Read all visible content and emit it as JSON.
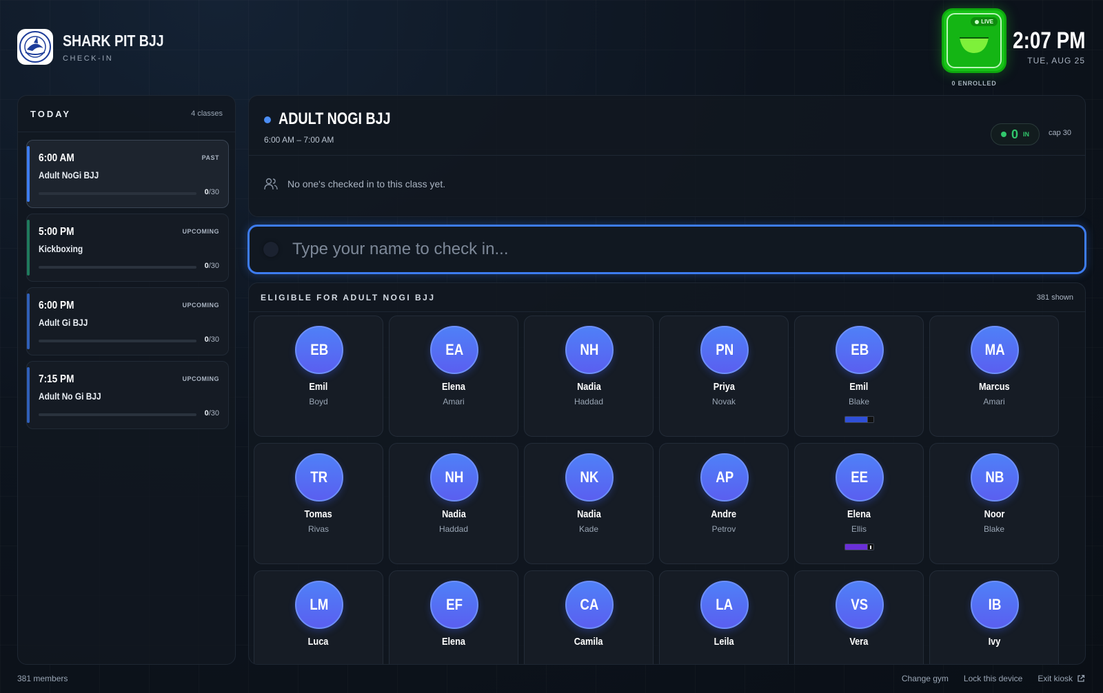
{
  "brand": {
    "name": "SHARK PIT BJJ",
    "subtitle": "CHECK-IN",
    "logo_text": "SHARK PIT BRAZILIAN JIU-JITSU"
  },
  "live": {
    "badge": "LIVE",
    "enrolled": "0 ENROLLED",
    "color": "#17c217"
  },
  "clock": {
    "time": "2:07 PM",
    "date": "TUE, AUG 25"
  },
  "sidebar": {
    "title": "TODAY",
    "count": "4 classes",
    "classes": [
      {
        "time": "6:00 AM",
        "status": "PAST",
        "name": "Adult NoGi BJJ",
        "checked": "0",
        "cap": "/30",
        "fill": 0,
        "accent": "#3d7cf0"
      },
      {
        "time": "5:00 PM",
        "status": "UPCOMING",
        "name": "Kickboxing",
        "checked": "0",
        "cap": "/30",
        "fill": 0,
        "accent": "#1f7a5c"
      },
      {
        "time": "6:00 PM",
        "status": "UPCOMING",
        "name": "Adult Gi BJJ",
        "checked": "0",
        "cap": "/30",
        "fill": 0,
        "accent": "#2f5fb8"
      },
      {
        "time": "7:15 PM",
        "status": "UPCOMING",
        "name": "Adult No Gi BJJ",
        "checked": "0",
        "cap": "/30",
        "fill": 0,
        "accent": "#2f5fb8"
      }
    ]
  },
  "class_panel": {
    "title": "ADULT NOGI BJJ",
    "times": "6:00 AM – 7:00 AM",
    "in_count": "0",
    "in_label": "IN",
    "cap": "cap 30",
    "empty_message": "No one's checked in to this class yet."
  },
  "search": {
    "placeholder": "Type your name to check in..."
  },
  "eligible": {
    "title": "ELIGIBLE FOR ADULT NOGI BJJ",
    "count": "381 shown",
    "members": [
      {
        "initials": "EB",
        "first": "Emil",
        "last": "Boyd"
      },
      {
        "initials": "EA",
        "first": "Elena",
        "last": "Amari"
      },
      {
        "initials": "NH",
        "first": "Nadia",
        "last": "Haddad"
      },
      {
        "initials": "PN",
        "first": "Priya",
        "last": "Novak"
      },
      {
        "initials": "EB",
        "first": "Emil",
        "last": "Blake",
        "belt": "blue"
      },
      {
        "initials": "MA",
        "first": "Marcus",
        "last": "Amari"
      },
      {
        "initials": "TR",
        "first": "Tomas",
        "last": "Rivas"
      },
      {
        "initials": "NH",
        "first": "Nadia",
        "last": "Haddad"
      },
      {
        "initials": "NK",
        "first": "Nadia",
        "last": "Kade"
      },
      {
        "initials": "AP",
        "first": "Andre",
        "last": "Petrov"
      },
      {
        "initials": "EE",
        "first": "Elena",
        "last": "Ellis",
        "belt": "purple"
      },
      {
        "initials": "NB",
        "first": "Noor",
        "last": "Blake"
      },
      {
        "initials": "LM",
        "first": "Luca",
        "last": ""
      },
      {
        "initials": "EF",
        "first": "Elena",
        "last": ""
      },
      {
        "initials": "CA",
        "first": "Camila",
        "last": ""
      },
      {
        "initials": "LA",
        "first": "Leila",
        "last": ""
      },
      {
        "initials": "VS",
        "first": "Vera",
        "last": ""
      },
      {
        "initials": "IB",
        "first": "Ivy",
        "last": ""
      }
    ]
  },
  "footer": {
    "members": "381 members",
    "change_gym": "Change gym",
    "lock": "Lock this device",
    "exit": "Exit kiosk"
  }
}
